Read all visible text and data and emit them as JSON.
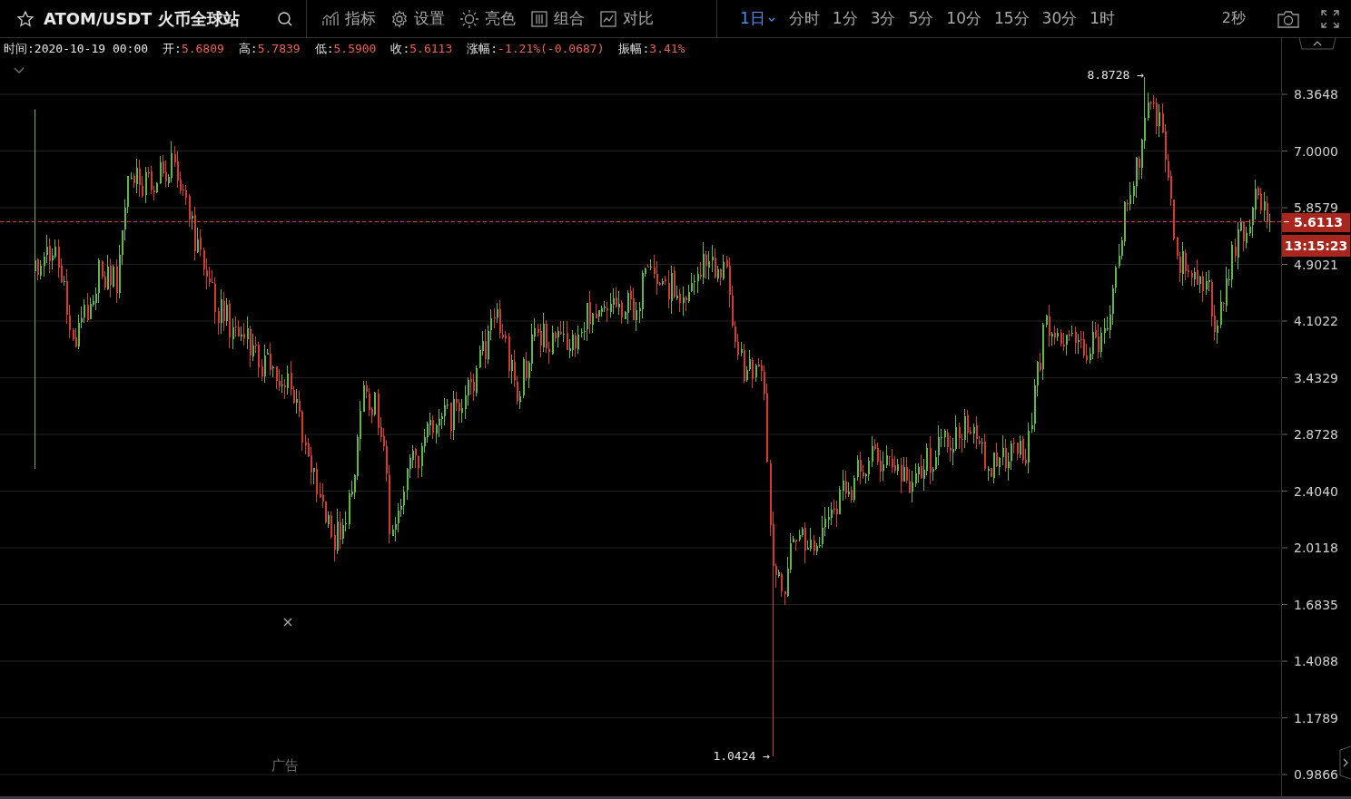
{
  "header": {
    "starred": false,
    "title": "ATOM/USDT 火币全球站"
  },
  "toolbar": [
    {
      "label": "指标",
      "kind": "indicator"
    },
    {
      "label": "设置",
      "kind": "settings"
    },
    {
      "label": "亮色",
      "kind": "theme"
    },
    {
      "label": "组合",
      "kind": "layout"
    },
    {
      "label": "对比",
      "kind": "compare"
    }
  ],
  "periods": [
    {
      "label": "1日",
      "selected": true
    },
    {
      "label": "分时",
      "selected": false
    },
    {
      "label": "1分",
      "selected": false
    },
    {
      "label": "3分",
      "selected": false
    },
    {
      "label": "5分",
      "selected": false
    },
    {
      "label": "10分",
      "selected": false
    },
    {
      "label": "15分",
      "selected": false
    },
    {
      "label": "30分",
      "selected": false
    },
    {
      "label": "1时",
      "selected": false
    }
  ],
  "refresh": "2秒",
  "ohlc_info": [
    {
      "label": "时间:",
      "value": "2020-10-19 00:00",
      "color": "#e6e6e6"
    },
    {
      "label": "开:",
      "value": "5.6809",
      "color": "#e8624e"
    },
    {
      "label": "高:",
      "value": "5.7839",
      "color": "#e8624e"
    },
    {
      "label": "低:",
      "value": "5.5900",
      "color": "#e8624e"
    },
    {
      "label": "收:",
      "value": "5.6113",
      "color": "#e8624e"
    },
    {
      "label": "涨幅:",
      "value": "-1.21%(-0.0687)",
      "color": "#e8624e"
    },
    {
      "label": "振幅:",
      "value": "3.41%",
      "color": "#e8624e"
    }
  ],
  "chart": {
    "y_labels": [
      "8.3648",
      "7.0000",
      "5.8579",
      "4.9021",
      "4.1022",
      "3.4329",
      "2.8728",
      "2.4040",
      "2.0118",
      "1.6835",
      "1.4088",
      "1.1789",
      "0.9866"
    ],
    "price_tag": "5.6113",
    "countdown": "13:15:23",
    "high_marker": "8.8728 →",
    "low_marker": "1.0424 →",
    "ad_label": "广告"
  }
}
